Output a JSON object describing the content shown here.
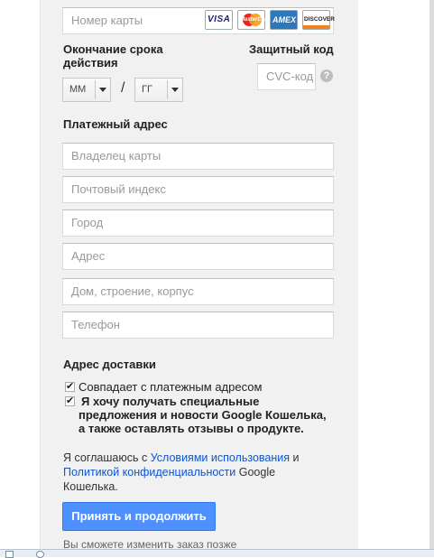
{
  "card": {
    "number_placeholder": "Номер карты",
    "brands": {
      "visa": "VISA",
      "mastercard": "MasterCard",
      "amex": "AMEX",
      "discover": "DISCOVER"
    }
  },
  "expiry": {
    "label_line1": "Окончание срока",
    "label_line2": "действия",
    "month_value": "ММ",
    "year_value": "ГГ",
    "separator": "/"
  },
  "security": {
    "label": "Защитный код",
    "cvc_placeholder": "CVC-код",
    "help": "?"
  },
  "billing": {
    "heading": "Платежный адрес",
    "fields": {
      "owner": "Владелец карты",
      "postal": "Почтовый индекс",
      "city": "Город",
      "address": "Адрес",
      "building": "Дом, строение, корпус",
      "phone": "Телефон"
    }
  },
  "shipping": {
    "heading": "Адрес доставки",
    "same_as_billing": "Совпадает с платежным адресом",
    "offers_line1": "Я хочу получать специальные",
    "offers_line2": "предложения и новости Google Кошелька,",
    "offers_line3": "а также оставлять отзывы о продукте."
  },
  "agreement": {
    "prefix": "Я соглашаюсь с ",
    "terms_link": "Условиями использования",
    "and": " и",
    "privacy_link": "Политикой конфиденциальности",
    "suffix1": " Google",
    "suffix2": "Кошелька."
  },
  "actions": {
    "submit": "Принять и продолжить",
    "hint": "Вы сможете изменить заказ позже"
  }
}
